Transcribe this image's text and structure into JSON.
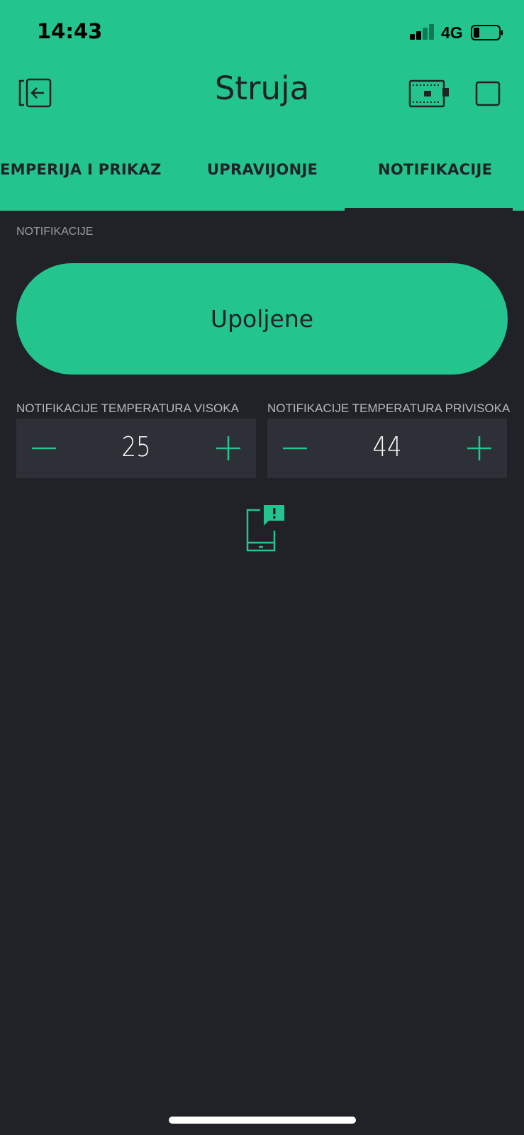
{
  "status_bar": {
    "time": "14:43",
    "network": "4G"
  },
  "header": {
    "title": "Struja",
    "icons": [
      "exit-icon",
      "device-board-icon",
      "square-icon"
    ]
  },
  "tabs": [
    {
      "label": "EMPERIJA I PRIKAZ",
      "active": false
    },
    {
      "label": "UPRAVIJONJE",
      "active": false
    },
    {
      "label": "NOTIFIKACIJE",
      "active": true
    }
  ],
  "main": {
    "section_label": "NOTIFIKACIJE",
    "toggle_button": {
      "label": "Upoljene"
    },
    "steppers": [
      {
        "label": "NOTIFIKACIJE TEMPERATURA VISOKA",
        "value": "25"
      },
      {
        "label": "NOTIFIKACIJE TEMPERATURA PRIVISOKA",
        "value": "44"
      }
    ],
    "notification_icon": "phone-notification-icon"
  },
  "colors": {
    "accent": "#23c48e",
    "background": "#212227",
    "widget_background": "#2e3037",
    "text_dark": "#1f2326"
  }
}
